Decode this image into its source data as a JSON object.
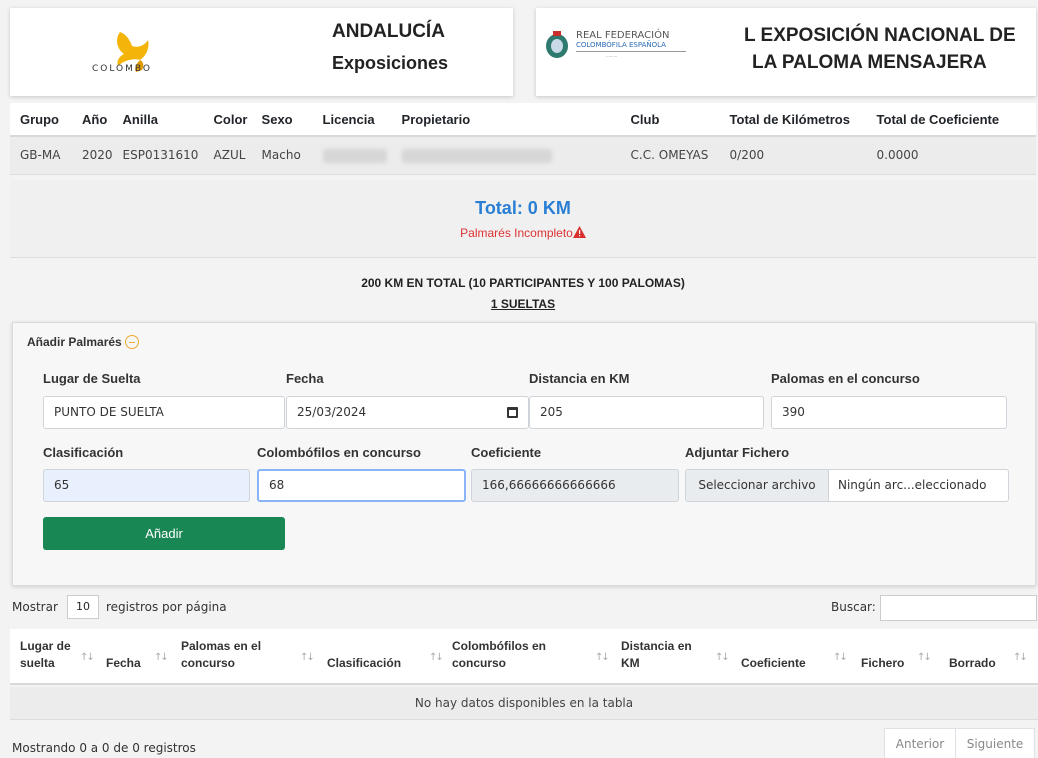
{
  "header": {
    "colombo_logo_text": "COLOMBO",
    "title": "ANDALUCÍA",
    "subtitle": "Exposiciones",
    "rfce_line1": "REAL FEDERACIÓN",
    "rfce_line2": "COLOMBÓFILA ESPAÑOLA",
    "expo_line1": "L EXPOSICIÓN NACIONAL DE",
    "expo_line2": "LA PALOMA MENSAJERA"
  },
  "pigeon_table": {
    "columns": [
      "Grupo",
      "Año",
      "Anilla",
      "Color",
      "Sexo",
      "Licencia",
      "Propietario",
      "Club",
      "Total de Kilómetros",
      "Total de Coeficiente"
    ],
    "row": {
      "grupo": "GB-MA",
      "anio": "2020",
      "anilla": "ESP0131610",
      "color": "AZUL",
      "sexo": "Macho",
      "club": "C.C. OMEYAS",
      "km": "0/200",
      "coef": "0.0000"
    }
  },
  "total": {
    "km": "Total: 0 KM",
    "warning": "Palmarés Incompleto"
  },
  "summary": {
    "line1": "200 KM EN TOTAL (10 PARTICIPANTES Y 100 PALOMAS)",
    "line2": "1 SUELTAS"
  },
  "form": {
    "title": "Añadir Palmarés",
    "lugar_label": "Lugar de Suelta",
    "lugar_value": "PUNTO DE SUELTA",
    "fecha_label": "Fecha",
    "fecha_value": "25/03/2024",
    "distancia_label": "Distancia en KM",
    "distancia_value": "205",
    "palomas_label": "Palomas en el concurso",
    "palomas_value": "390",
    "clasificacion_label": "Clasificación",
    "clasificacion_value": "65",
    "colombofilos_label": "Colombófilos en concurso",
    "colombofilos_value": "68",
    "coeficiente_label": "Coeficiente",
    "coeficiente_value": "166,66666666666666",
    "fichero_label": "Adjuntar Fichero",
    "fichero_button": "Seleccionar archivo",
    "fichero_name": "Ningún arc...eleccionado",
    "add_button": "Añadir"
  },
  "datatable": {
    "show_prefix": "Mostrar",
    "show_value": "10",
    "show_suffix": "registros por página",
    "search_label": "Buscar:",
    "columns": {
      "lugar_1": "Lugar de",
      "lugar_2": "suelta",
      "fecha": "Fecha",
      "palomas_1": "Palomas en el",
      "palomas_2": "concurso",
      "clasificacion": "Clasificación",
      "colombofilos_1": "Colombófilos en",
      "colombofilos_2": "concurso",
      "distancia_1": "Distancia en",
      "distancia_2": "KM",
      "coeficiente": "Coeficiente",
      "fichero": "Fichero",
      "borrado": "Borrado"
    },
    "empty": "No hay datos disponibles en la tabla",
    "info": "Mostrando 0 a 0 de 0 registros",
    "prev": "Anterior",
    "next": "Siguiente"
  }
}
